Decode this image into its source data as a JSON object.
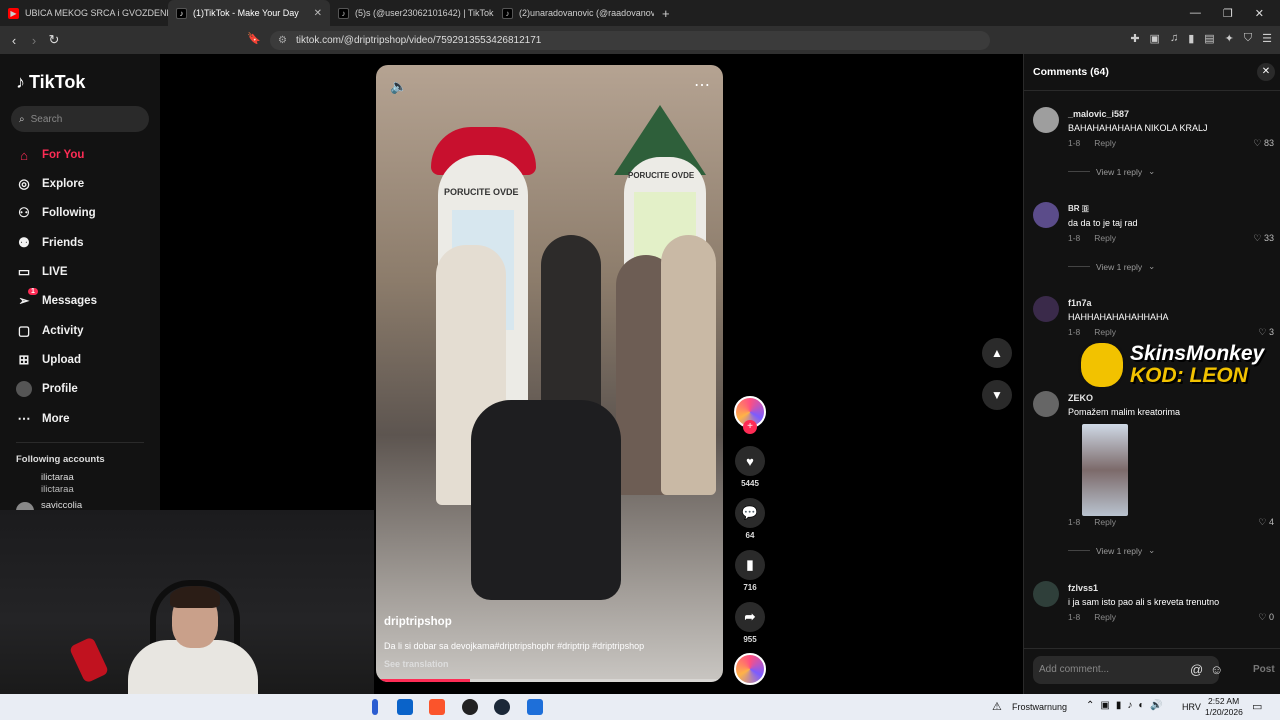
{
  "browser": {
    "tabs": [
      {
        "label": "UBICA MEKOG SRCA i GVOZDENE PE",
        "fav": "youtube-icon",
        "color": "#ff0000"
      },
      {
        "label": "(1)TikTok - Make Your Day",
        "fav": "tiktok-icon",
        "color": "#000000"
      },
      {
        "label": "(5)s (@user23062101642) | TikTok",
        "fav": "tiktok-icon",
        "color": "#000000"
      },
      {
        "label": "(2)unaradovanovic (@raadovanovic",
        "fav": "tiktok-icon",
        "color": "#000000"
      }
    ],
    "url": "tiktok.com/@driptripshop/video/7592913553426812171"
  },
  "sidebar": {
    "logo": "TikTok",
    "search_placeholder": "Search",
    "nav": [
      {
        "label": "For You",
        "icon": "home-icon"
      },
      {
        "label": "Explore",
        "icon": "compass-icon"
      },
      {
        "label": "Following",
        "icon": "following-icon"
      },
      {
        "label": "Friends",
        "icon": "friends-icon"
      },
      {
        "label": "LIVE",
        "icon": "live-icon"
      },
      {
        "label": "Messages",
        "icon": "messages-icon",
        "badge": "1"
      },
      {
        "label": "Activity",
        "icon": "activity-icon"
      },
      {
        "label": "Upload",
        "icon": "upload-icon"
      },
      {
        "label": "Profile",
        "icon": "profile-icon"
      },
      {
        "label": "More",
        "icon": "more-icon"
      }
    ],
    "following_header": "Following accounts",
    "accounts": [
      {
        "name": "ilictaraa",
        "handle": "ilictaraa"
      },
      {
        "name": "saviccolia"
      }
    ]
  },
  "video": {
    "username": "driptripshop",
    "description": "Da li si dobar sa devojkama#driptripshophr #driptrip #driptripshop",
    "see_translation": "See translation",
    "progress": 0.27,
    "sign_left": "PORUCITE OVDE",
    "sign_right": "PORUCITE OVDE"
  },
  "actions": {
    "likes": "5445",
    "comments": "64",
    "saves": "716",
    "shares": "955"
  },
  "comments": {
    "header": "Comments (64)",
    "items": [
      {
        "user": "_malovic_i587",
        "text": "BAHAHAHAHAHA NIKOLA KRALJ",
        "date": "1-8",
        "reply": "Reply",
        "likes": "83",
        "view": "View 1 reply"
      },
      {
        "user": "BR 🇧",
        "text": "da da to je taj rad",
        "date": "1-8",
        "reply": "Reply",
        "likes": "33",
        "view": "View 1 reply"
      },
      {
        "user": "f1n7a",
        "text": "HAHHAHAHAHAHHAHA",
        "date": "1-8",
        "reply": "Reply",
        "likes": "3"
      },
      {
        "user": "ZEKO",
        "text": "Pomažem malim kreatorima",
        "date": "1-8",
        "reply": "Reply",
        "likes": "4",
        "view": "View 1 reply"
      },
      {
        "user": "fzlvss1",
        "text": "i ja sam isto pao ali s kreveta trenutno",
        "date": "1-8",
        "reply": "Reply",
        "likes": "0"
      }
    ],
    "input_placeholder": "Add comment...",
    "post_label": "Post"
  },
  "overlay": {
    "line1": "SkinsMonkey",
    "line2": "KOD: LEON"
  },
  "taskbar": {
    "weather": "Frostwarnung",
    "lang": "HRV",
    "time": "2:52 AM",
    "date": "1/20/2026"
  }
}
